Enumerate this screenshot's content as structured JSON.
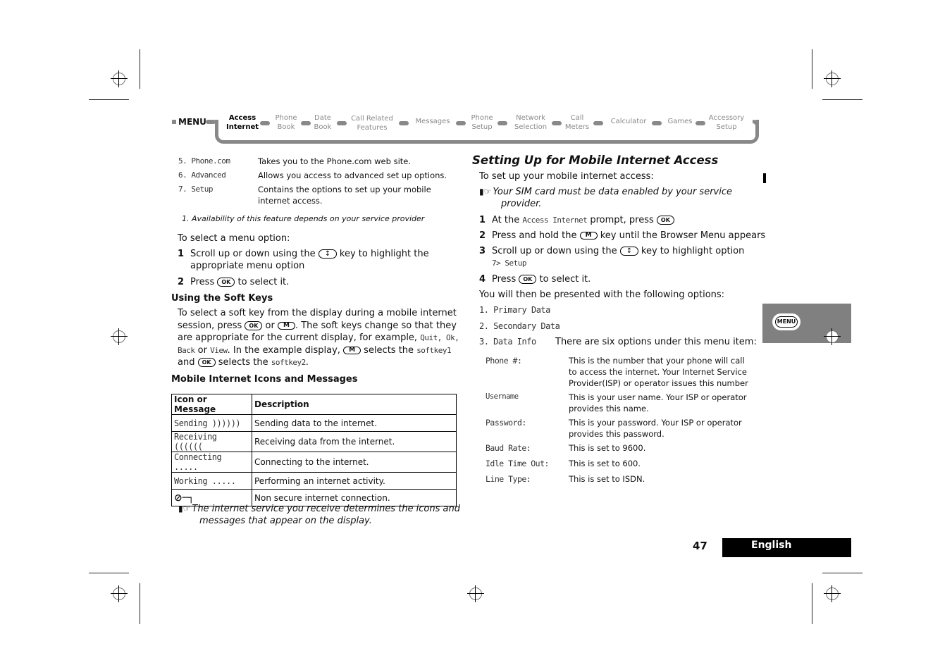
{
  "nav": {
    "menu_label": "MENU",
    "items": [
      {
        "l1": "Access",
        "l2": "Internet",
        "active": true
      },
      {
        "l1": "Phone",
        "l2": "Book"
      },
      {
        "l1": "Date",
        "l2": "Book"
      },
      {
        "l1": "Call Related",
        "l2": "Features"
      },
      {
        "l1": "Messages",
        "l2": ""
      },
      {
        "l1": "Phone",
        "l2": "Setup"
      },
      {
        "l1": "Network",
        "l2": "Selection"
      },
      {
        "l1": "Call",
        "l2": "Meters"
      },
      {
        "l1": "Calculator",
        "l2": ""
      },
      {
        "l1": "Games",
        "l2": ""
      },
      {
        "l1": "Accessory",
        "l2": "Setup"
      }
    ]
  },
  "left": {
    "menu_options": [
      {
        "code": "5. Phone.com",
        "desc": "Takes you to the Phone.com web site."
      },
      {
        "code": "6. Advanced",
        "desc": "Allows you access to advanced set up options."
      },
      {
        "code": "7. Setup",
        "desc": "Contains the options to set up your mobile internet access."
      }
    ],
    "footnote": "1.   Availability of this feature depends on your service provider",
    "select_intro": "To select a menu option:",
    "step1_num": "1",
    "step1_a": "Scroll up or down using the",
    "step1_b": "key to highlight the appropriate menu option",
    "step2_num": "2",
    "step2_a": "Press",
    "step2_b": "to select it.",
    "soft_keys_heading": "Using the Soft Keys",
    "soft_keys_p1": "To select a soft key from the display during a mobile internet session, press",
    "soft_keys_or": "or",
    "soft_keys_p2": ". The soft keys change so that they are appropriate for the current display, for example,",
    "soft_keys_examples": "Quit, Ok, Back",
    "soft_keys_or2": "or",
    "soft_keys_view": "View",
    "soft_keys_p3": ". In the example display,",
    "soft_keys_p4": "selects the",
    "softkey1": "softkey1",
    "soft_keys_and": "and",
    "soft_keys_p5": "selects the",
    "softkey2": "softkey2",
    "icons_heading": "Mobile Internet Icons and Messages",
    "table_headers": [
      "Icon or Message",
      "Description"
    ],
    "table_rows": [
      {
        "msg": "Sending ))))))",
        "desc": "Sending data to the internet."
      },
      {
        "msg": "Receiving ((((((",
        "desc": "Receiving data from the internet."
      },
      {
        "msg": "Connecting .....",
        "desc": "Connecting to the internet."
      },
      {
        "msg": "Working .....",
        "desc": "Performing an internet activity."
      },
      {
        "msg": "no-secure-key-icon",
        "desc": "Non secure internet connection."
      }
    ],
    "note": "The internet service you receive determines the icons and messages that appear on the display."
  },
  "right": {
    "heading": "Setting Up for Mobile Internet Access",
    "intro": "To set up your mobile internet access:",
    "note": "Your SIM card must be data enabled by your service provider.",
    "steps": [
      {
        "num": "1",
        "a": "At the",
        "code": "Access Internet",
        "b": "prompt, press"
      },
      {
        "num": "2",
        "a": "Press and hold the",
        "b": "key until the Browser Menu appears"
      },
      {
        "num": "3",
        "a": "Scroll up or down using the",
        "b": "key to highlight option",
        "code": "7> Setup"
      },
      {
        "num": "4",
        "a": "Press",
        "b": "to select it."
      }
    ],
    "presented": "You will then be presented with the following options:",
    "options": [
      "1. Primary Data",
      "2. Secondary Data",
      "3. Data Info"
    ],
    "data_info_desc": "There are six options under this menu item:",
    "sub_options": [
      {
        "code": "Phone #:",
        "desc": "This is the number that your phone will call to access the internet. Your Internet Service Provider(ISP) or operator issues this number"
      },
      {
        "code": "Username",
        "desc": "This is your user name. Your ISP or operator provides this name."
      },
      {
        "code": "Password:",
        "desc": "This is your password. Your ISP or operator provides this password."
      },
      {
        "code": "Baud Rate:",
        "desc": "This is set to 9600."
      },
      {
        "code": "Idle Time Out:",
        "desc": "This is set to 600."
      },
      {
        "code": "Line Type:",
        "desc": "This is set to ISDN."
      }
    ]
  },
  "keys": {
    "ok": "OK",
    "m": "M",
    "menu": "MENU"
  },
  "side_tab": {
    "menu_key": "MENU"
  },
  "footer": {
    "page_number": "47",
    "language": "English"
  }
}
